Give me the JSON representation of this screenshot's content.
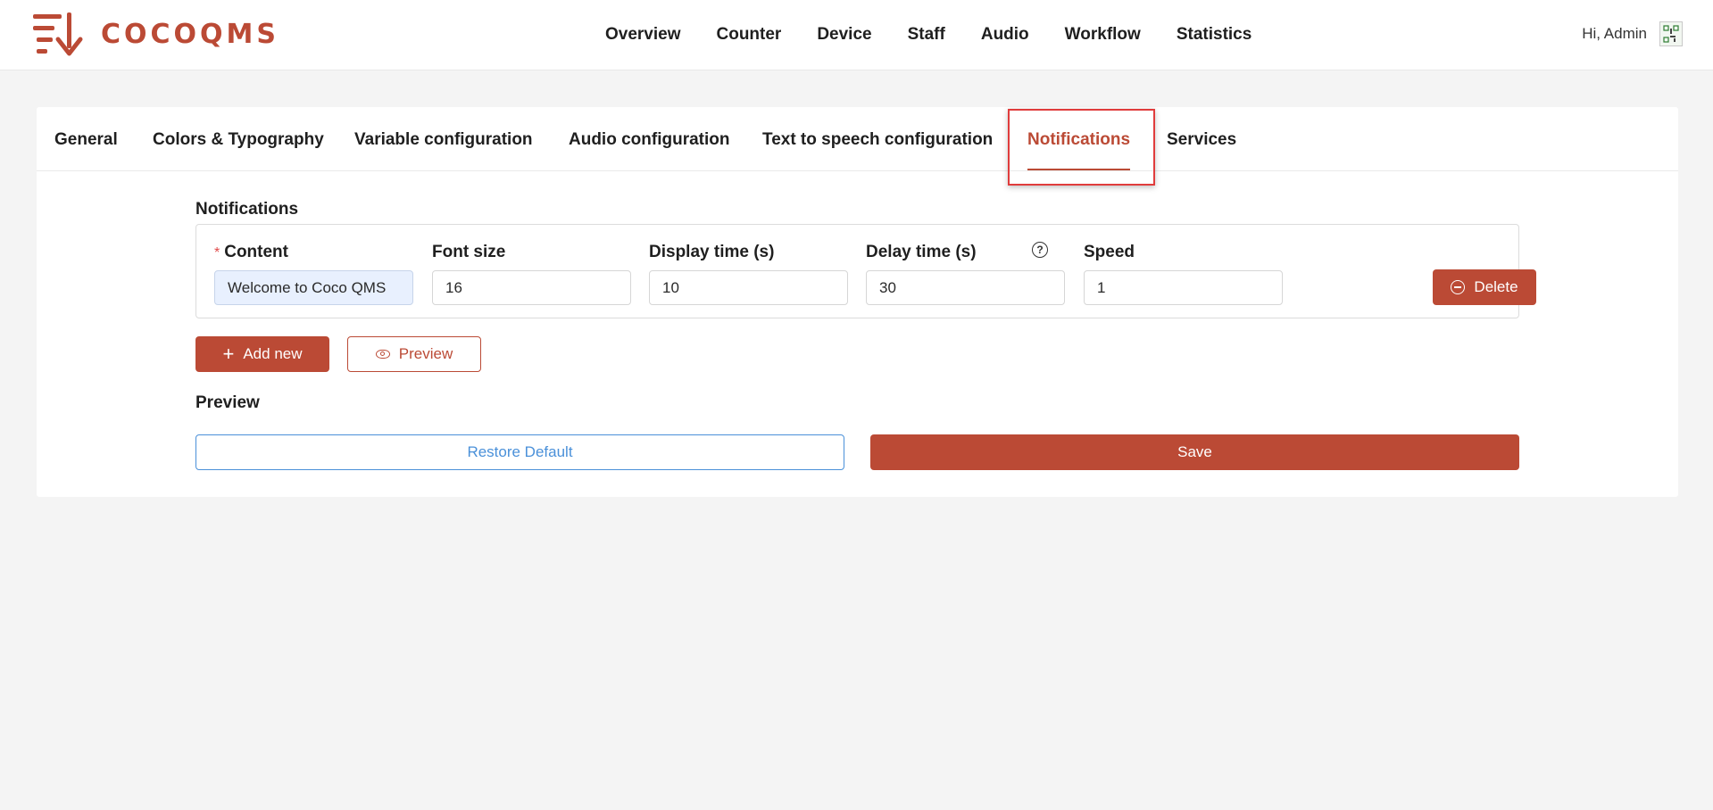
{
  "app": {
    "logo_text": "COCOQMS",
    "brand_color": "#bb4a35"
  },
  "top_nav": {
    "items": [
      {
        "label": "Overview"
      },
      {
        "label": "Counter"
      },
      {
        "label": "Device"
      },
      {
        "label": "Staff"
      },
      {
        "label": "Audio"
      },
      {
        "label": "Workflow"
      },
      {
        "label": "Statistics"
      }
    ]
  },
  "user": {
    "greeting": "Hi, Admin",
    "avatar_icon": "qr-avatar-icon"
  },
  "settings_tabs": {
    "items": [
      {
        "label": "General"
      },
      {
        "label": "Colors & Typography"
      },
      {
        "label": "Variable configuration"
      },
      {
        "label": "Audio configuration"
      },
      {
        "label": "Text to speech configuration"
      },
      {
        "label": "Notifications"
      },
      {
        "label": "Services"
      }
    ],
    "active": "Notifications"
  },
  "notifications": {
    "section_title": "Notifications",
    "required_mark": "*",
    "columns": {
      "content": "Content",
      "font_size": "Font size",
      "display_time": "Display time (s)",
      "delay_time": "Delay time (s)",
      "speed": "Speed"
    },
    "help_icon": "?",
    "rows": [
      {
        "content": "Welcome to Coco QMS",
        "font_size": "16",
        "display_time": "10",
        "delay_time": "30",
        "speed": "1"
      }
    ],
    "delete_label": "Delete",
    "add_new_label": "Add new",
    "preview_label": "Preview"
  },
  "preview_section": {
    "title": "Preview"
  },
  "footer_actions": {
    "restore_label": "Restore Default",
    "save_label": "Save"
  }
}
